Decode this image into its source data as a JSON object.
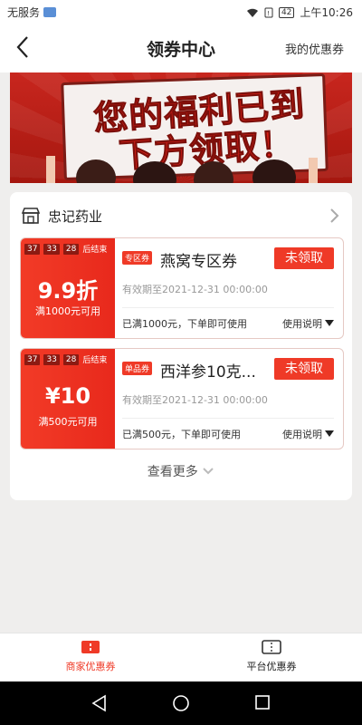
{
  "status_bar": {
    "carrier": "无服务",
    "battery": "42",
    "time": "上午10:26"
  },
  "header": {
    "title": "领券中心",
    "my_coupons": "我的优惠券"
  },
  "banner": {
    "line1": "您的福利已到",
    "line2": "下方领取！"
  },
  "store": {
    "name": "忠记药业"
  },
  "coupons": [
    {
      "timer": [
        "37",
        "33",
        "28"
      ],
      "timer_suffix": "后结束",
      "amount": "9.9折",
      "condition": "满1000元可用",
      "tag": "专区券",
      "title": "燕窝专区券",
      "claim": "未领取",
      "validity": "有效期至2021-12-31 00:00:00",
      "desc": "已满1000元，下单即可使用",
      "usage": "使用说明"
    },
    {
      "timer": [
        "37",
        "33",
        "28"
      ],
      "timer_suffix": "后结束",
      "amount": "¥10",
      "condition": "满500元可用",
      "tag": "单品券",
      "title": "西洋参10克...",
      "claim": "未领取",
      "validity": "有效期至2021-12-31 00:00:00",
      "desc": "已满500元，下单即可使用",
      "usage": "使用说明"
    }
  ],
  "more": "查看更多",
  "tabs": [
    {
      "label": "商家优惠券",
      "active": true
    },
    {
      "label": "平台优惠券",
      "active": false
    }
  ],
  "colors": {
    "accent": "#ef3a27",
    "deep_red": "#8c1a12"
  }
}
